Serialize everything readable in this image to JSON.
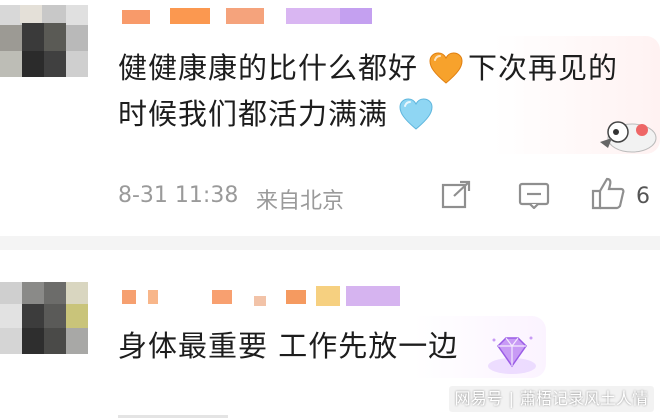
{
  "comments": [
    {
      "text_line1": "健健康康的比什么都好",
      "text_line1b": "下次再见的",
      "text_line2": "时候我们都活力满满",
      "emoji_1": "orange-heart",
      "emoji_2": "light-blue-heart",
      "date": "8-31 11:38",
      "location": "来自北京",
      "likes": "6"
    },
    {
      "text": "身体最重要 工作先放一边",
      "badge": "purple-gem-badge"
    }
  ],
  "watermark": {
    "platform": "网易号",
    "account": "蕭梧记录风土人情"
  },
  "colors": {
    "orange_heart": "#f7a22c",
    "blue_heart": "#8fd6f3",
    "meta_gray": "#9a9a9a"
  }
}
